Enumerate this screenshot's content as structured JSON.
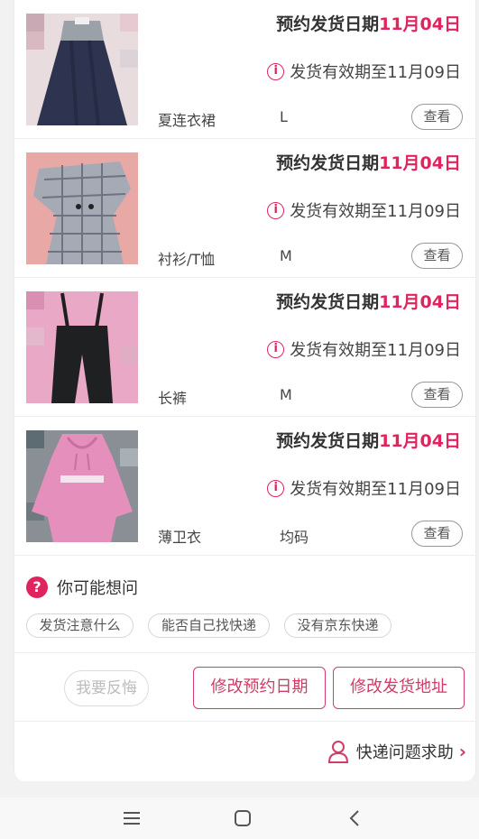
{
  "items": [
    {
      "ship_label": "预约发货日期",
      "ship_date": "11月04日",
      "validity": "发货有效期至11月09日",
      "category": "夏连衣裙",
      "size": "L",
      "view_label": "查看",
      "image": "dress"
    },
    {
      "ship_label": "预约发货日期",
      "ship_date": "11月04日",
      "validity": "发货有效期至11月09日",
      "category": "衬衫/T恤",
      "size": "M",
      "view_label": "查看",
      "image": "plaid-top"
    },
    {
      "ship_label": "预约发货日期",
      "ship_date": "11月04日",
      "validity": "发货有效期至11月09日",
      "category": "长裤",
      "size": "M",
      "view_label": "查看",
      "image": "black-overalls"
    },
    {
      "ship_label": "预约发货日期",
      "ship_date": "11月04日",
      "validity": "发货有效期至11月09日",
      "category": "薄卫衣",
      "size": "均码",
      "view_label": "查看",
      "image": "pink-hoodie"
    }
  ],
  "info_icon": "i",
  "faq": {
    "icon": "?",
    "title": "你可能想问",
    "chips": [
      "发货注意什么",
      "能否自己找快递",
      "没有京东快递"
    ]
  },
  "actions": {
    "regret": "我要反悔",
    "change_date": "修改预约日期",
    "change_address": "修改发货地址"
  },
  "help": {
    "label": "快递问题求助",
    "chevron": "›"
  },
  "colors": {
    "accent": "#e0245e",
    "button_border": "#d23c66"
  }
}
